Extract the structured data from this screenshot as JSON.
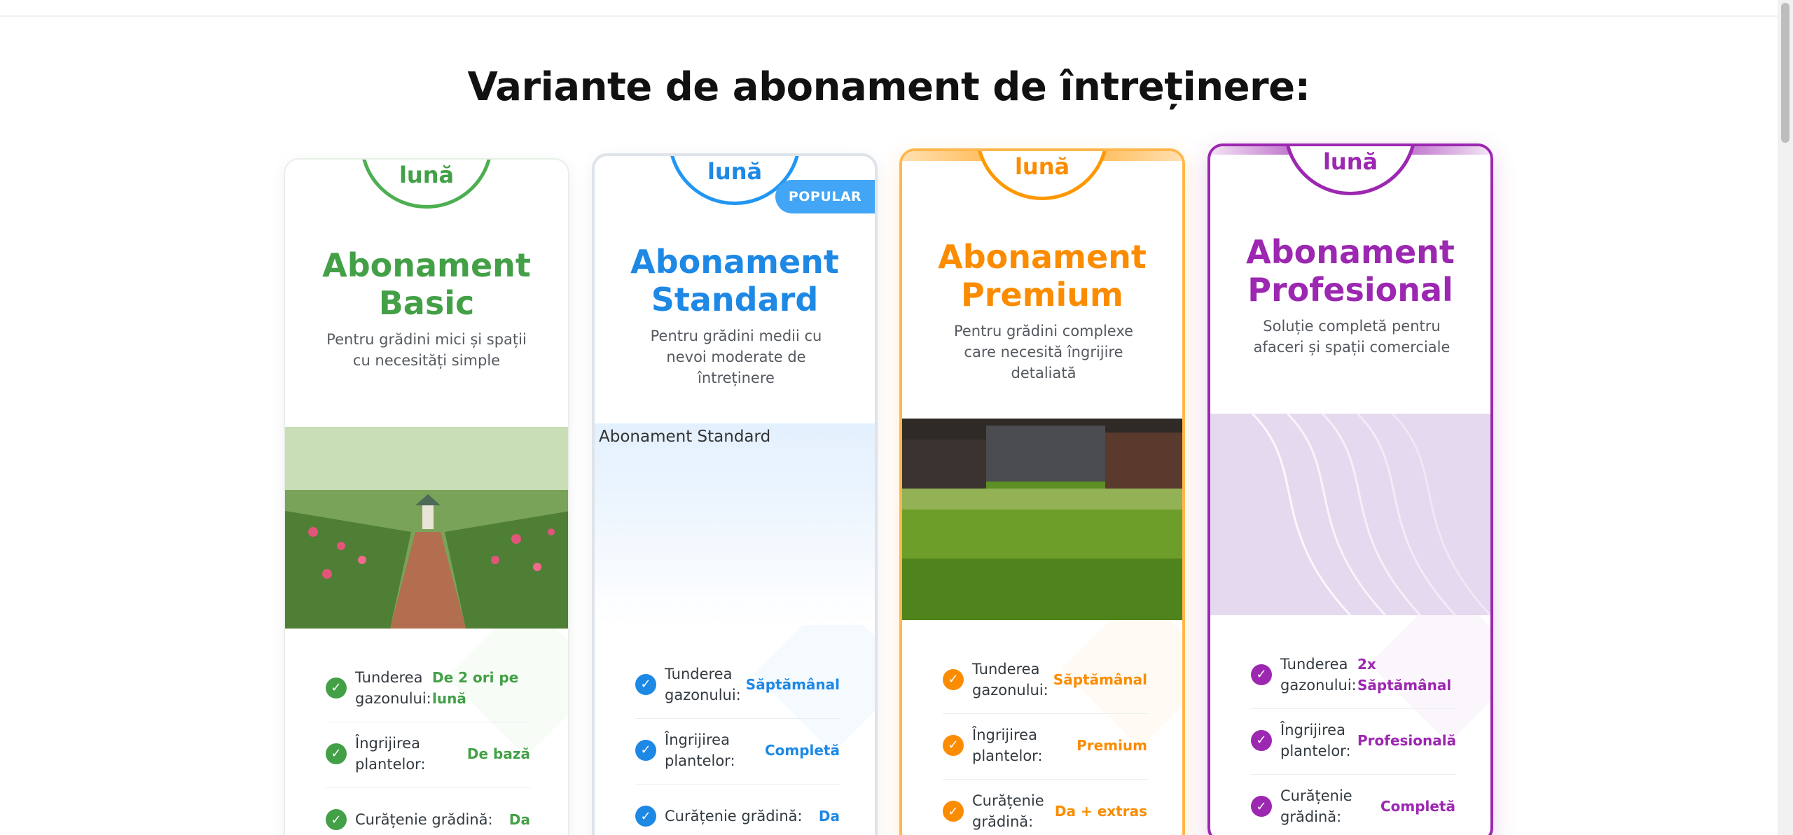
{
  "section": {
    "title": "Variante de abonament de întreținere:"
  },
  "cards": [
    {
      "price_suffix": "lună",
      "title": "Abonament Basic",
      "description": "Pentru grădini mici și spații cu necesități simple",
      "features": [
        {
          "label": "Tunderea gazonului:",
          "value": "De 2 ori pe lună"
        },
        {
          "label": "Îngrijirea plantelor:",
          "value": "De bază"
        },
        {
          "label": "Curățenie grădină:",
          "value": "Da"
        }
      ],
      "accent": "#43a047"
    },
    {
      "price_suffix": "lună",
      "badge": "POPULAR",
      "title": "Abonament Standard",
      "description": "Pentru grădini medii cu nevoi moderate de întreținere",
      "image_alt": "Abonament Standard",
      "features": [
        {
          "label": "Tunderea gazonului:",
          "value": "Săptămânal"
        },
        {
          "label": "Îngrijirea plantelor:",
          "value": "Completă"
        },
        {
          "label": "Curățenie grădină:",
          "value": "Da"
        }
      ],
      "accent": "#1e88e5"
    },
    {
      "price_suffix": "lună",
      "title": "Abonament Premium",
      "description": "Pentru grădini complexe care necesită îngrijire detaliată",
      "features": [
        {
          "label": "Tunderea gazonului:",
          "value": "Săptămânal"
        },
        {
          "label": "Îngrijirea plantelor:",
          "value": "Premium"
        },
        {
          "label": "Curățenie grădină:",
          "value": "Da + extras"
        }
      ],
      "accent": "#fb8c00"
    },
    {
      "price_suffix": "lună",
      "title": "Abonament Profesional",
      "description": "Soluție completă pentru afaceri și spații comerciale",
      "features": [
        {
          "label": "Tunderea gazonului:",
          "value": "2x Săptămânal"
        },
        {
          "label": "Îngrijirea plantelor:",
          "value": "Profesională"
        },
        {
          "label": "Curățenie grădină:",
          "value": "Completă"
        }
      ],
      "accent": "#9c27b0"
    }
  ],
  "icons": {
    "feature_check": "check-icon"
  }
}
